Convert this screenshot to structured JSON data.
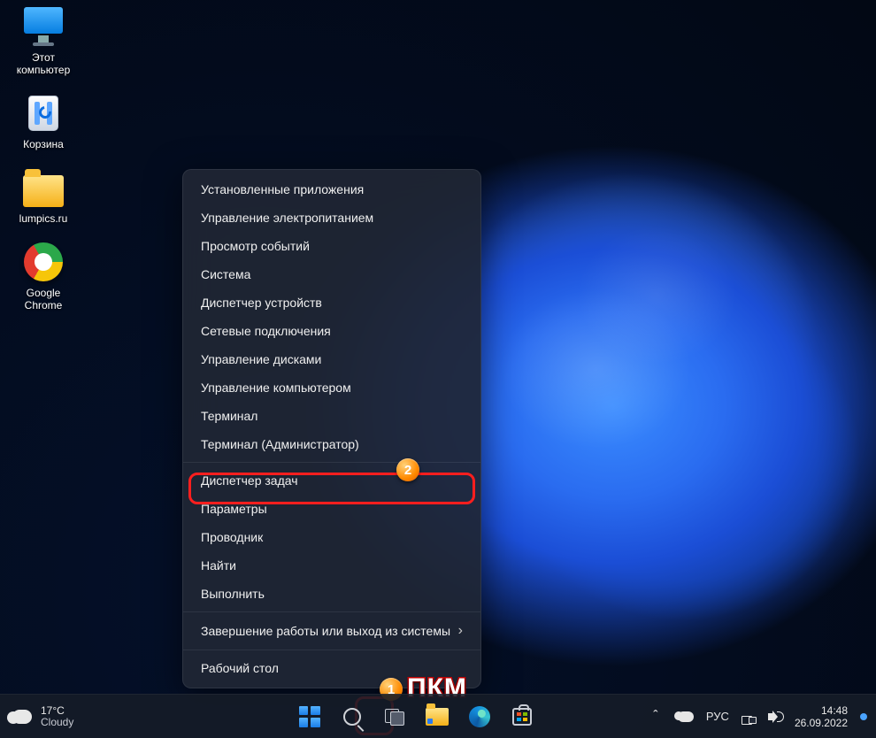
{
  "desktop": {
    "icons": [
      {
        "name": "this-pc",
        "label": "Этот\nкомпьютер"
      },
      {
        "name": "recycle",
        "label": "Корзина"
      },
      {
        "name": "folder",
        "label": "lumpics.ru"
      },
      {
        "name": "chrome",
        "label": "Google\nChrome"
      }
    ]
  },
  "winx_menu": {
    "items": [
      "Установленные приложения",
      "Управление электропитанием",
      "Просмотр событий",
      "Система",
      "Диспетчер устройств",
      "Сетевые подключения",
      "Управление дисками",
      "Управление компьютером",
      "Терминал",
      "Терминал (Администратор)"
    ],
    "items2": [
      "Диспетчер задач",
      "Параметры",
      "Проводник",
      "Найти",
      "Выполнить"
    ],
    "items3": [
      {
        "label": "Завершение работы или выход из системы",
        "submenu": true
      },
      {
        "label": "Рабочий стол",
        "submenu": false
      }
    ]
  },
  "annotation": {
    "badge1": "1",
    "badge2": "2",
    "hint_text": "ПКМ"
  },
  "taskbar": {
    "weather": {
      "temp": "17°C",
      "cond": "Cloudy"
    },
    "lang": "РУС",
    "time": "14:48",
    "date": "26.09.2022",
    "tray_chevron": "ˆ"
  }
}
